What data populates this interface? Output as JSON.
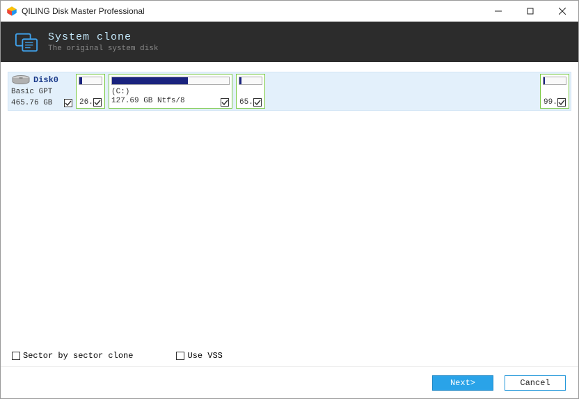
{
  "titlebar": {
    "title": "QILING Disk Master Professional"
  },
  "header": {
    "title": "System clone",
    "subtitle": "The original system disk"
  },
  "disk": {
    "name": "Disk0",
    "type": "Basic GPT",
    "size": "465.76 GB",
    "checked": true,
    "partitions": [
      {
        "fill": 12,
        "leftnum": "26.",
        "label1": "",
        "label2": "",
        "checked": true
      },
      {
        "fill": 65,
        "leftnum": "",
        "label1": "(C:)",
        "label2": "127.69 GB Ntfs/8",
        "checked": true
      },
      {
        "fill": 8,
        "leftnum": "65.",
        "label1": "",
        "label2": "",
        "checked": true
      },
      {
        "fill": 6,
        "leftnum": "99.",
        "label1": "",
        "label2": "",
        "checked": true
      }
    ]
  },
  "options": {
    "sector": "Sector by sector clone",
    "vss": "Use VSS"
  },
  "footer": {
    "next": "Next>",
    "cancel": "Cancel"
  }
}
